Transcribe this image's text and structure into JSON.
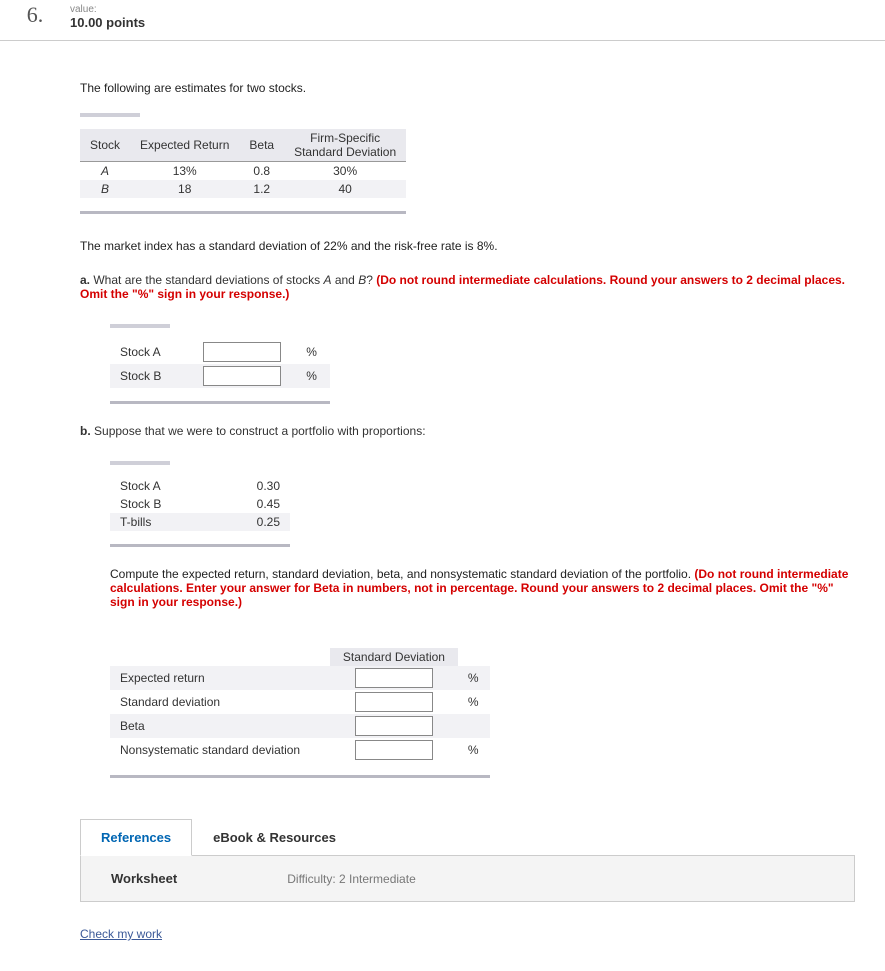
{
  "header": {
    "qnum": "6.",
    "value_label": "value:",
    "points": "10.00 points"
  },
  "intro": "The following are estimates for two stocks.",
  "stockTable": {
    "headers": [
      "Stock",
      "Expected Return",
      "Beta",
      "Firm-Specific Standard Deviation"
    ],
    "rows": [
      {
        "stock": "A",
        "er": "13%",
        "beta": "0.8",
        "fsd": "30%"
      },
      {
        "stock": "B",
        "er": "18",
        "beta": "1.2",
        "fsd": "40"
      }
    ]
  },
  "market_stmt": "The market index has a standard deviation of 22% and the risk-free rate is 8%.",
  "partA": {
    "letter": "a.",
    "q_prefix": "What are the standard deviations of stocks ",
    "q_Aand": "A",
    "q_and": " and ",
    "q_B": "B",
    "q_suffix": "? ",
    "instr": "(Do not round intermediate calculations. Round your answers to 2 decimal places. Omit the \"%\" sign in your response.)",
    "rows": [
      {
        "label": "Stock A",
        "unit": "%"
      },
      {
        "label": "Stock B",
        "unit": "%"
      }
    ]
  },
  "partB": {
    "letter": "b.",
    "q": "Suppose that we were to construct a portfolio with proportions:",
    "propTable": [
      {
        "label": "Stock A",
        "val": "0.30"
      },
      {
        "label": "Stock B",
        "val": "0.45"
      },
      {
        "label": "T-bills",
        "val": "0.25"
      }
    ],
    "compute_text": "Compute the expected return, standard deviation, beta, and nonsystematic standard deviation of the portfolio. ",
    "instr": "(Do not round intermediate calculations. Enter your answer for Beta in numbers, not in percentage. Round your answers to 2 decimal places. Omit the \"%\" sign in your response.)",
    "ansHeader": "Standard Deviation",
    "ansRows": [
      {
        "label": "Expected return",
        "unit": "%"
      },
      {
        "label": "Standard deviation",
        "unit": "%"
      },
      {
        "label": "Beta",
        "unit": ""
      },
      {
        "label": "Nonsystematic standard deviation",
        "unit": "%"
      }
    ]
  },
  "tabs": {
    "t1": "References",
    "t2": "eBook & Resources",
    "panel": {
      "worksheet": "Worksheet",
      "difficulty": "Difficulty: 2 Intermediate"
    }
  },
  "check_link": "Check my work"
}
